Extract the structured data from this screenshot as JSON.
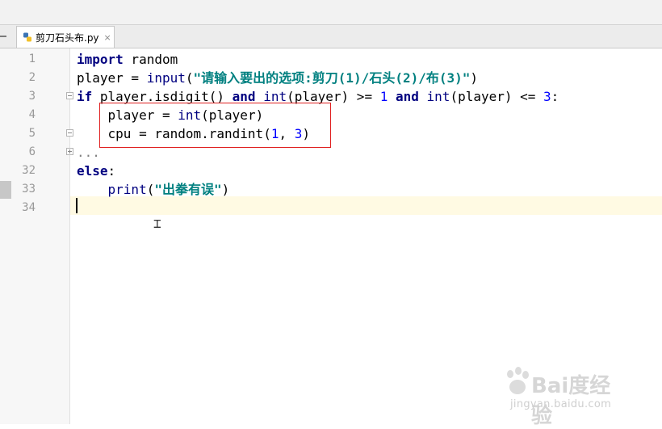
{
  "tab": {
    "filename": "剪刀石头布.py",
    "close_glyph": "×",
    "icon": "python-file-icon"
  },
  "gutter": {
    "line_numbers": [
      "1",
      "2",
      "3",
      "4",
      "5",
      "6",
      "32",
      "33",
      "34"
    ]
  },
  "code": {
    "l1": {
      "kw": "import",
      "rest": " random"
    },
    "l2": {
      "a": "player = ",
      "fn": "input",
      "b": "(",
      "str": "\"请输入要出的选项:剪刀(1)/石头(2)/布(3)\"",
      "c": ")"
    },
    "l3": {
      "kw1": "if",
      "a": " player.isdigit() ",
      "kw2": "and",
      "sp": " ",
      "fn1": "int",
      "b": "(player) >= ",
      "n1": "1",
      "sp2": " ",
      "kw3": "and",
      "sp3": " ",
      "fn2": "int",
      "c": "(player) <= ",
      "n2": "3",
      "d": ":"
    },
    "l4": {
      "a": "    player = ",
      "fn": "int",
      "b": "(player)"
    },
    "l5": {
      "a": "    cpu = random.randint(",
      "n1": "1",
      "b": ", ",
      "n2": "3",
      "c": ")"
    },
    "l6": {
      "folded": "..."
    },
    "l32": {
      "kw": "else",
      "rest": ":"
    },
    "l33": {
      "a": "    ",
      "fn": "print",
      "b": "(",
      "str": "\"出拳有误\"",
      "c": ")"
    },
    "l34": {
      "text": ""
    }
  },
  "watermark": {
    "brand": "Bai度经验",
    "url": "jingyan.baidu.com"
  }
}
